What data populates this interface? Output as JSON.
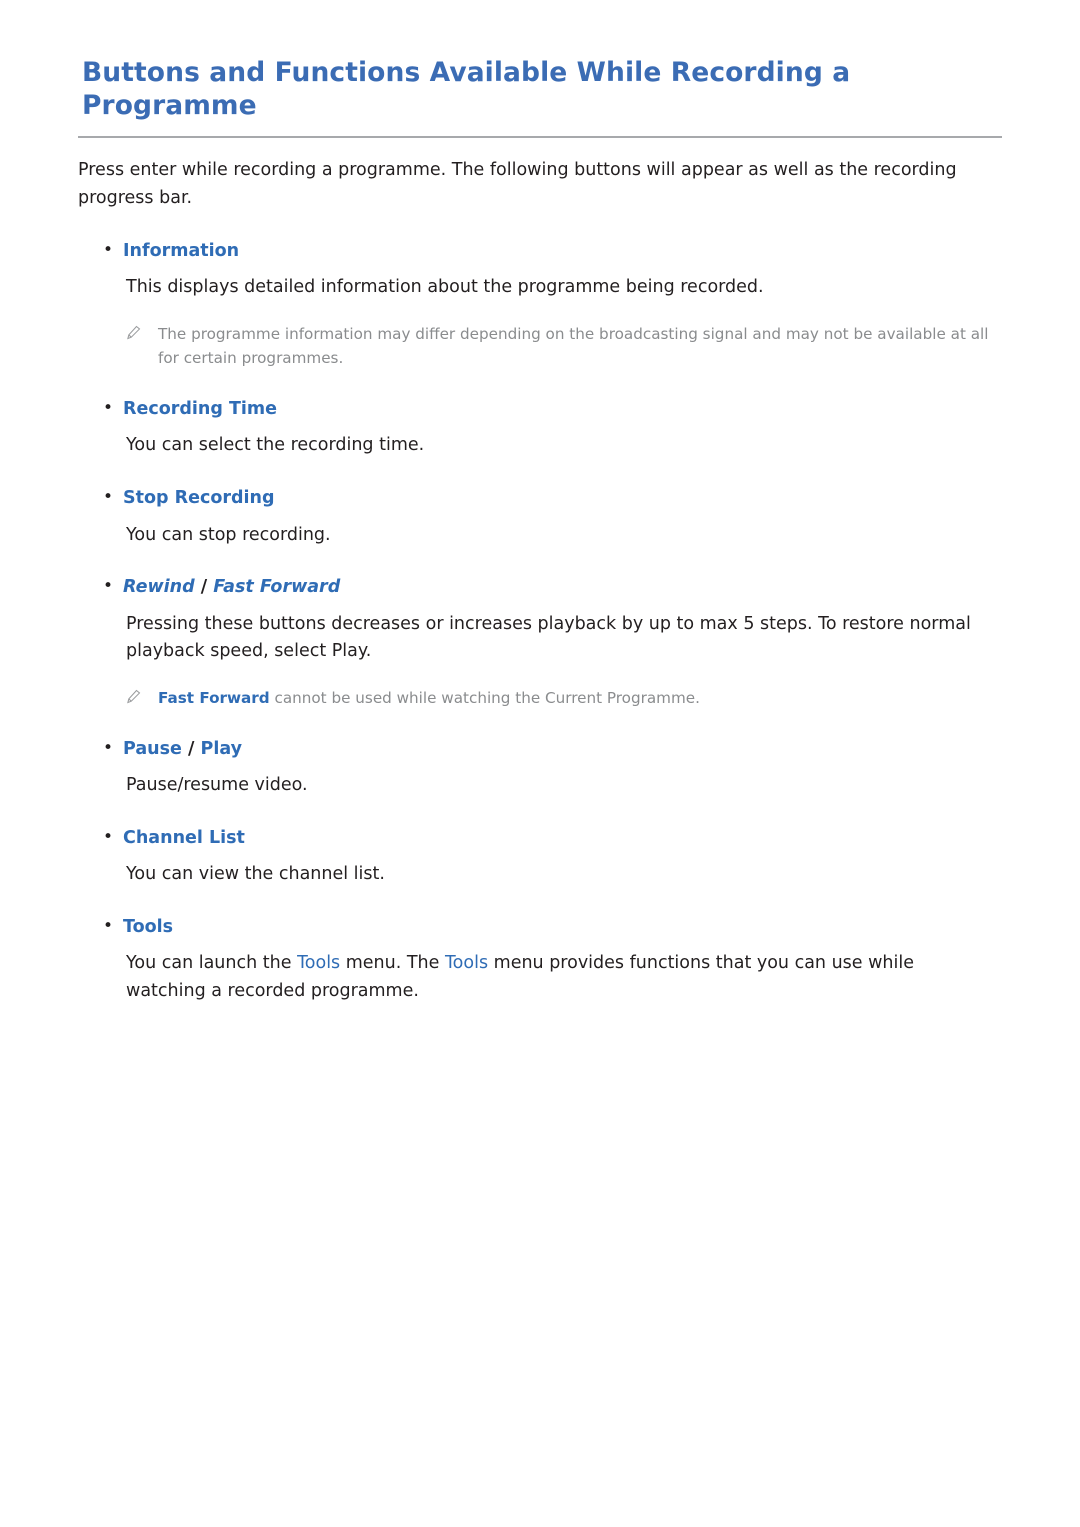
{
  "page": {
    "title": "Buttons and Functions Available While Recording a Programme",
    "intro": "Press enter while recording a programme. The following buttons will appear as well as the recording progress bar.",
    "accent_color": "#2f6cb5",
    "title_color": "#3b6cb4",
    "note_color": "#8a8c8e",
    "body_color": "#231f20"
  },
  "sections": [
    {
      "label": "Information",
      "body": "This displays detailed information about the programme being recorded.",
      "note": {
        "icon": "pencil-icon",
        "text": "The programme information may differ depending on the broadcasting signal and may not be available at all for certain programmes."
      }
    },
    {
      "label": "Recording Time",
      "body": "You can select the recording time."
    },
    {
      "label": "Stop Recording",
      "body": "You can stop recording."
    },
    {
      "label_parts": {
        "first": "Rewind",
        "sep": " / ",
        "second": "Fast Forward"
      },
      "body": "Pressing these buttons decreases or increases playback by up to max 5 steps. To restore normal playback speed, select Play.",
      "note": {
        "icon": "pencil-icon",
        "highlight": "Fast Forward",
        "text": " cannot be used while watching the Current Programme."
      }
    },
    {
      "label_parts": {
        "first": "Pause",
        "sep": " / ",
        "second": "Play"
      },
      "body": "Pause/resume video."
    },
    {
      "label": "Channel List",
      "body": "You can view the channel list."
    },
    {
      "label": "Tools",
      "body_parts": {
        "p1": "You can launch the ",
        "kw1": "Tools",
        "p2": " menu. The ",
        "kw2": "Tools",
        "p3": " menu provides functions that you can use while watching a recorded programme."
      }
    }
  ]
}
